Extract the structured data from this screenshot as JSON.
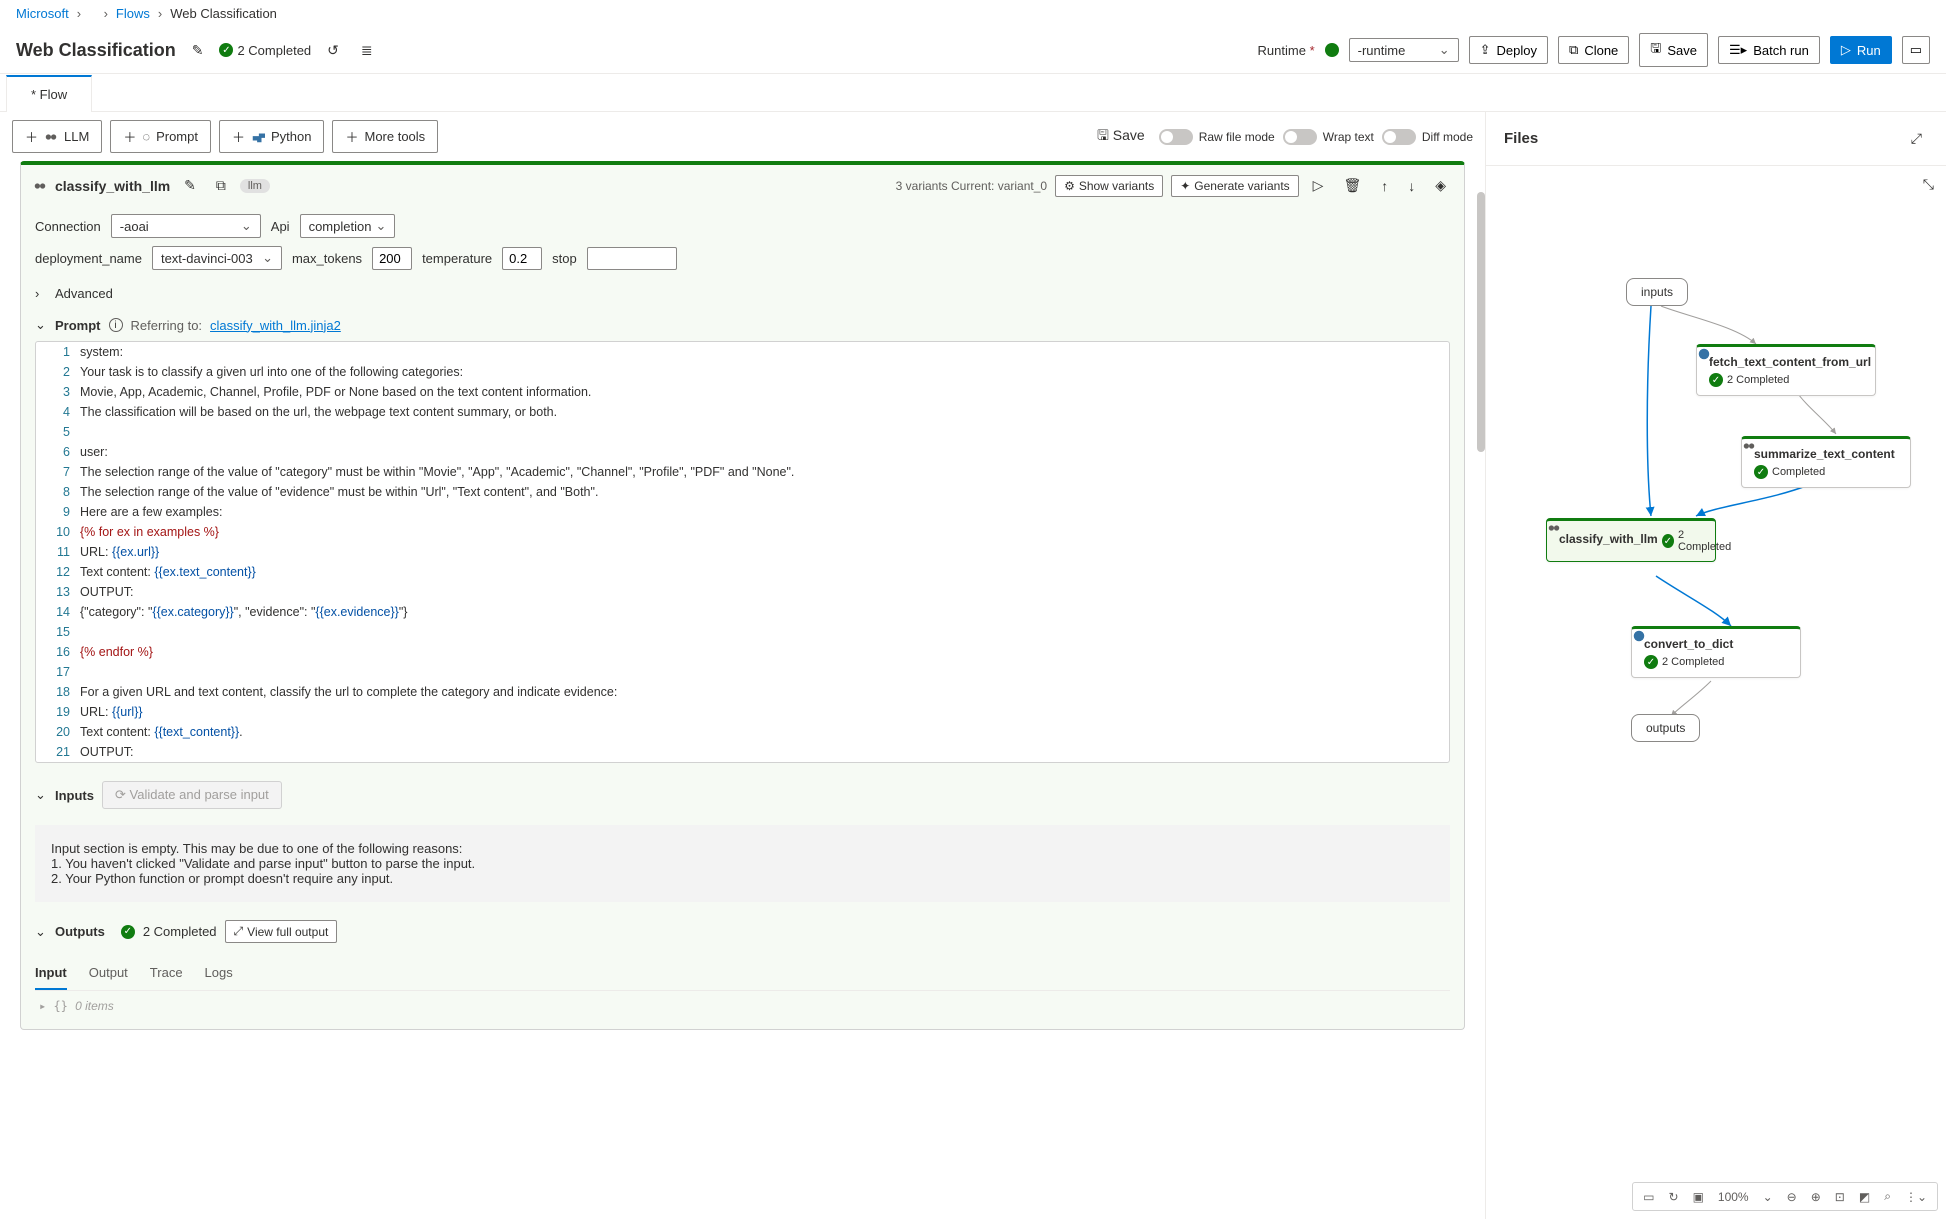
{
  "breadcrumb": {
    "root": "Microsoft",
    "flows": "Flows",
    "current": "Web Classification"
  },
  "header": {
    "title": "Web Classification",
    "status": "2 Completed",
    "runtime_label": "Runtime",
    "runtime_value": "-runtime",
    "deploy": "Deploy",
    "clone": "Clone",
    "save": "Save",
    "batch": "Batch run",
    "run": "Run"
  },
  "tab": "* Flow",
  "toolbar": {
    "llm": "LLM",
    "prompt": "Prompt",
    "python": "Python",
    "more": "More tools",
    "save": "Save",
    "raw": "Raw file mode",
    "wrap": "Wrap text",
    "diff": "Diff mode"
  },
  "node": {
    "name": "classify_with_llm",
    "tag": "llm",
    "variants_info": "3 variants  Current: variant_0",
    "show_variants": "Show variants",
    "gen_variants": "Generate variants",
    "conn_label": "Connection",
    "conn_value": "-aoai",
    "api_label": "Api",
    "api_value": "completion",
    "dep_label": "deployment_name",
    "dep_value": "text-davinci-003",
    "max_label": "max_tokens",
    "max_value": "200",
    "temp_label": "temperature",
    "temp_value": "0.2",
    "stop_label": "stop",
    "stop_value": "",
    "advanced": "Advanced",
    "prompt_label": "Prompt",
    "ref_label": "Referring to:",
    "ref_file": "classify_with_llm.jinja2"
  },
  "code": [
    "system:",
    "Your task is to classify a given url into one of the following categories:",
    "Movie, App, Academic, Channel, Profile, PDF or None based on the text content information.",
    "The classification will be based on the url, the webpage text content summary, or both.",
    "",
    "user:",
    "The selection range of the value of \"category\" must be within \"Movie\", \"App\", \"Academic\", \"Channel\", \"Profile\", \"PDF\" and \"None\".",
    "The selection range of the value of \"evidence\" must be within \"Url\", \"Text content\", and \"Both\".",
    "Here are a few examples:",
    "{% for ex in examples %}",
    "URL: {{ex.url}}",
    "Text content: {{ex.text_content}}",
    "OUTPUT:",
    "{\"category\": \"{{ex.category}}\", \"evidence\": \"{{ex.evidence}}\"}",
    "",
    "{% endfor %}",
    "",
    "For a given URL and text content, classify the url to complete the category and indicate evidence:",
    "URL: {{url}}",
    "Text content: {{text_content}}.",
    "OUTPUT:"
  ],
  "inputs": {
    "label": "Inputs",
    "validate": "Validate and parse input",
    "msg": "Input section is empty. This may be due to one of the following reasons:",
    "r1": "1. You haven't clicked \"Validate and parse input\" button to parse the input.",
    "r2": "2. Your Python function or prompt doesn't require any input."
  },
  "outputs": {
    "label": "Outputs",
    "status": "2 Completed",
    "view": "View full output",
    "tabs": [
      "Input",
      "Output",
      "Trace",
      "Logs"
    ],
    "items": "0 items"
  },
  "files": {
    "title": "Files"
  },
  "graph": {
    "inputs": "inputs",
    "outputs": "outputs",
    "n1": {
      "t": "fetch_text_content_from_url",
      "s": "2 Completed"
    },
    "n2": {
      "t": "summarize_text_content",
      "s": "Completed"
    },
    "n3": {
      "t": "classify_with_llm",
      "s": "2 Completed"
    },
    "n4": {
      "t": "convert_to_dict",
      "s": "2 Completed"
    },
    "zoom": "100%"
  }
}
